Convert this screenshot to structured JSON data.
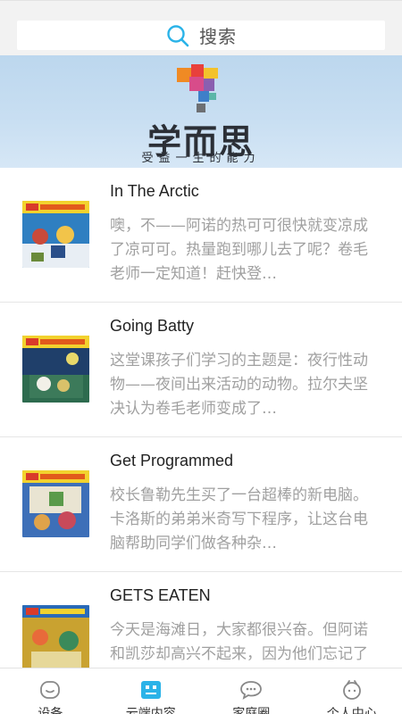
{
  "search": {
    "placeholder": "搜索"
  },
  "banner": {
    "brand": "学而思",
    "slogan": "受益一生的能力"
  },
  "items": [
    {
      "title": "In The Arctic",
      "desc": "噢，不——阿诺的热可可很快就变凉成了凉可可。热量跑到哪儿去了呢？卷毛老师一定知道！赶快登…",
      "cover_color": "#2f7fc1"
    },
    {
      "title": "Going Batty",
      "desc": "这堂课孩子们学习的主题是：夜行性动物——夜间出来活动的动物。拉尔夫坚决认为卷毛老师变成了…",
      "cover_color": "#2d6b4e"
    },
    {
      "title": "Get Programmed",
      "desc": "校长鲁勒先生买了一台超棒的新电脑。卡洛斯的弟弟米奇写下程序，让这台电脑帮助同学们做各种杂…",
      "cover_color": "#3d6fb8"
    },
    {
      "title": "GETS EATEN",
      "desc": "今天是海滩日，大家都很兴奋。但阿诺和凯莎却高兴不起来，因为他们忘记了作业报告，卷毛老师会和…",
      "cover_color": "#c9a230"
    }
  ],
  "tabs": [
    {
      "label": "设备",
      "icon": "device-icon"
    },
    {
      "label": "云端内容",
      "icon": "cloud-content-icon"
    },
    {
      "label": "家庭圈",
      "icon": "chat-icon"
    },
    {
      "label": "个人中心",
      "icon": "profile-icon"
    }
  ],
  "colors": {
    "accent": "#2bb3e8",
    "banner": "#c4dbf0"
  }
}
